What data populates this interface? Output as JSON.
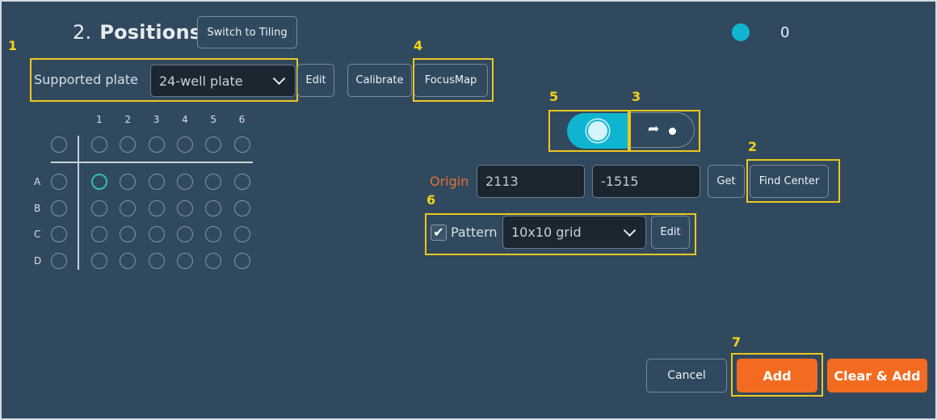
{
  "section": {
    "number": "2.",
    "title": "Positions"
  },
  "buttons": {
    "switch_tiling": "Switch to Tiling",
    "plate_edit": "Edit",
    "calibrate": "Calibrate",
    "focusmap": "FocusMap",
    "get": "Get",
    "find_center": "Find Center",
    "pattern_edit": "Edit",
    "cancel": "Cancel",
    "add": "Add",
    "clear_add": "Clear & Add"
  },
  "status": {
    "indicator_color": "#0fb5d0",
    "count": "0"
  },
  "plate": {
    "label": "Supported plate",
    "selected": "24-well plate"
  },
  "well_grid": {
    "columns": [
      "1",
      "2",
      "3",
      "4",
      "5",
      "6"
    ],
    "rows": [
      "A",
      "B",
      "C",
      "D"
    ],
    "selected_well": "A1"
  },
  "mode_toggle": {
    "active": "live-position",
    "options": [
      "live-position-icon",
      "move-to-icon"
    ]
  },
  "origin": {
    "label": "Origin",
    "x": "2113",
    "y": "-1515",
    "label_color": "#e0703a"
  },
  "pattern": {
    "checked": true,
    "label": "Pattern",
    "selected": "10x10 grid"
  },
  "annotations": {
    "a1": "1",
    "a2": "2",
    "a3": "3",
    "a4": "4",
    "a5": "5",
    "a6": "6",
    "a7": "7"
  },
  "colors": {
    "accent": "#f26b21",
    "toggle": "#0fb5d0",
    "highlight": "#ecc81e",
    "selected_well": "#2cc4a3"
  }
}
